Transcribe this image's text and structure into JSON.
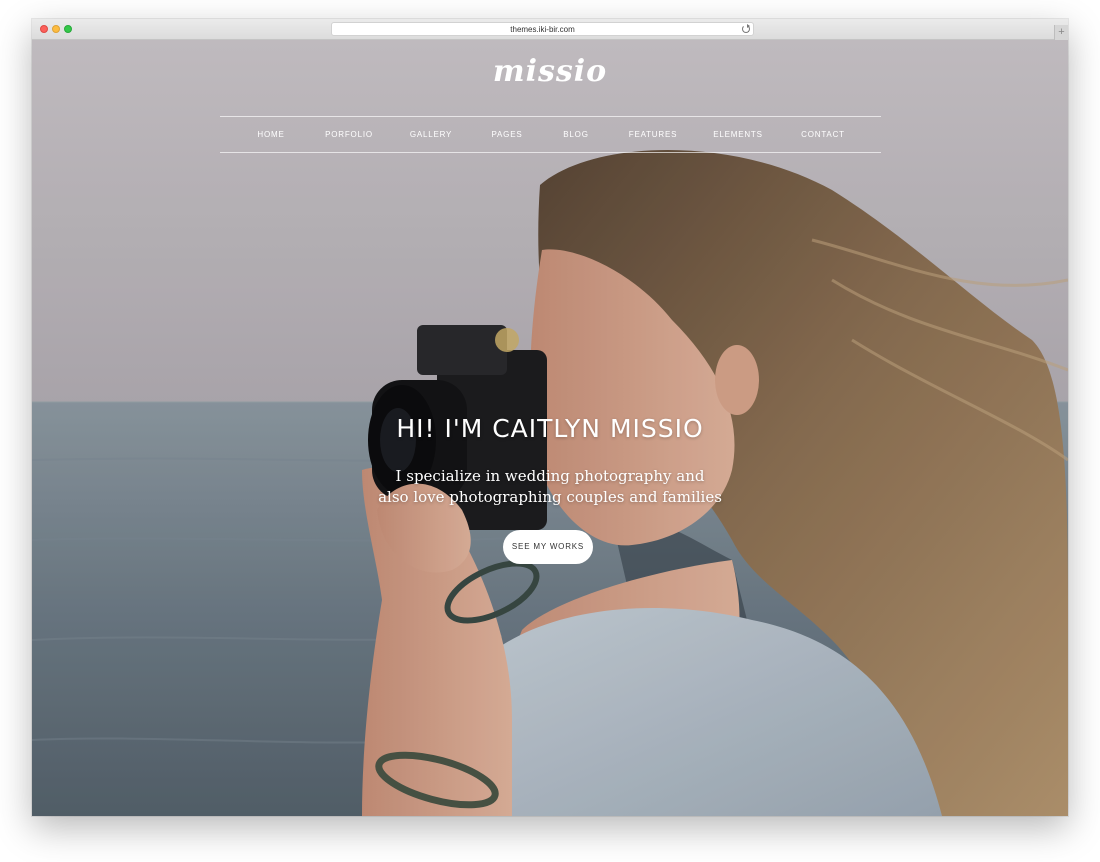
{
  "browser": {
    "url": "themes.iki-bir.com"
  },
  "site": {
    "logo": "missio",
    "nav": [
      "HOME",
      "PORFOLIO",
      "GALLERY",
      "PAGES",
      "BLOG",
      "FEATURES",
      "ELEMENTS",
      "CONTACT"
    ]
  },
  "hero": {
    "title": "HI! I'M CAITLYN MISSIO",
    "subtitle_line1": "I specialize in wedding photography and",
    "subtitle_line2": "also love photographing couples and families",
    "cta_label": "SEE MY WORKS"
  },
  "colors": {
    "sky": "#c9c4c8",
    "sea": "#6f7d88",
    "hair": "#8a6e4f",
    "skin": "#d9a890",
    "shirt": "#b9c4cf",
    "camera": "#1d1d1f"
  }
}
